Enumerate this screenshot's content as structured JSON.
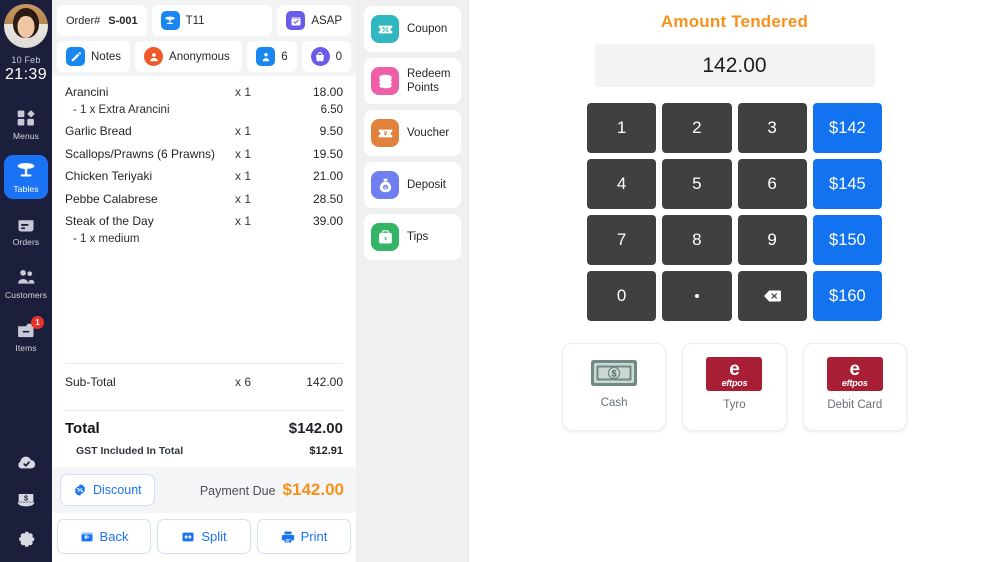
{
  "sidebar": {
    "user": {
      "date": "10 Feb",
      "time": "21:39"
    },
    "items": [
      {
        "label": "Menus",
        "icon": "grid-icon",
        "active": false
      },
      {
        "label": "Tables",
        "icon": "table-icon",
        "active": true
      },
      {
        "label": "Orders",
        "icon": "receipt-icon",
        "active": false
      },
      {
        "label": "Customers",
        "icon": "users-icon",
        "active": false
      },
      {
        "label": "Items",
        "icon": "drawer-icon",
        "active": false,
        "badge": "1"
      }
    ],
    "bottom_icons": [
      "cloud-check-icon",
      "cash-drawer-icon",
      "gear-icon"
    ]
  },
  "order": {
    "chips_row1": [
      {
        "name": "order-number-chip",
        "prefix": "Order#",
        "value": "S-001"
      },
      {
        "name": "table-chip",
        "value": "T11",
        "icon": "table-icon"
      },
      {
        "name": "asap-chip",
        "value": "ASAP",
        "icon": "calendar-check-icon"
      }
    ],
    "chips_row2": [
      {
        "name": "notes-chip",
        "value": "Notes",
        "icon": "pencil-icon"
      },
      {
        "name": "customer-chip",
        "value": "Anonymous",
        "icon": "person-icon"
      },
      {
        "name": "guests-chip",
        "value": "6",
        "icon": "person-seat-icon"
      },
      {
        "name": "bag-chip",
        "value": "0",
        "icon": "shopping-bag-icon"
      }
    ],
    "line_items": [
      {
        "name": "Arancini",
        "qty": "x 1",
        "price": "18.00",
        "modifiers": [
          {
            "name": "- 1 x Extra Arancini",
            "price": "6.50"
          }
        ]
      },
      {
        "name": "Garlic Bread",
        "qty": "x 1",
        "price": "9.50",
        "modifiers": []
      },
      {
        "name": "Scallops/Prawns (6 Prawns)",
        "qty": "x 1",
        "price": "19.50",
        "modifiers": []
      },
      {
        "name": "Chicken Teriyaki",
        "qty": "x 1",
        "price": "21.00",
        "modifiers": []
      },
      {
        "name": "Pebbe Calabrese",
        "qty": "x 1",
        "price": "28.50",
        "modifiers": []
      },
      {
        "name": "Steak of the Day",
        "qty": "x 1",
        "price": "39.00",
        "modifiers": [
          {
            "name": "- 1 x medium",
            "price": ""
          }
        ]
      }
    ],
    "subtotal": {
      "label": "Sub-Total",
      "qty": "x 6",
      "price": "142.00"
    },
    "total": {
      "label": "Total",
      "price": "$142.00"
    },
    "gst": {
      "label": "GST Included In Total",
      "price": "$12.91"
    },
    "discount_label": "Discount",
    "payment_due_label": "Payment Due",
    "payment_due_amount": "$142.00",
    "buttons": [
      {
        "label": "Back",
        "icon": "back-icon"
      },
      {
        "label": "Split",
        "icon": "split-icon"
      },
      {
        "label": "Print",
        "icon": "printer-icon"
      }
    ]
  },
  "actions": [
    {
      "label": "Coupon",
      "icon": "coupon-icon",
      "color": "#31b7c0"
    },
    {
      "label": "Redeem Points",
      "icon": "coins-icon",
      "color": "#ef5fa7"
    },
    {
      "label": "Voucher",
      "icon": "voucher-icon",
      "color": "#e0813c"
    },
    {
      "label": "Deposit",
      "icon": "money-bag-icon",
      "color": "#6f7ff0"
    },
    {
      "label": "Tips",
      "icon": "tips-icon",
      "color": "#34b566"
    }
  ],
  "payment": {
    "title": "Amount Tendered",
    "tendered_value": "142.00",
    "keypad": [
      {
        "label": "1",
        "type": "digit"
      },
      {
        "label": "2",
        "type": "digit"
      },
      {
        "label": "3",
        "type": "digit"
      },
      {
        "label": "$142",
        "type": "quick"
      },
      {
        "label": "4",
        "type": "digit"
      },
      {
        "label": "5",
        "type": "digit"
      },
      {
        "label": "6",
        "type": "digit"
      },
      {
        "label": "$145",
        "type": "quick"
      },
      {
        "label": "7",
        "type": "digit"
      },
      {
        "label": "8",
        "type": "digit"
      },
      {
        "label": "9",
        "type": "digit"
      },
      {
        "label": "$150",
        "type": "quick"
      },
      {
        "label": "0",
        "type": "digit"
      },
      {
        "label": ".",
        "type": "dot"
      },
      {
        "label": "",
        "type": "backspace"
      },
      {
        "label": "$160",
        "type": "quick"
      }
    ],
    "methods": [
      {
        "label": "Cash",
        "icon": "banknote-icon"
      },
      {
        "label": "Tyro",
        "icon": "eftpos-logo",
        "logo_text": "e",
        "logo_word": "eftpos"
      },
      {
        "label": "Debit Card",
        "icon": "eftpos-logo",
        "logo_text": "e",
        "logo_word": "eftpos"
      }
    ]
  },
  "colors": {
    "accent_orange": "#f5921e",
    "accent_blue": "#1a73f5",
    "sidebar_bg": "#1b1f3b",
    "key_dark": "#404040",
    "eftpos_red": "#a81f35"
  }
}
